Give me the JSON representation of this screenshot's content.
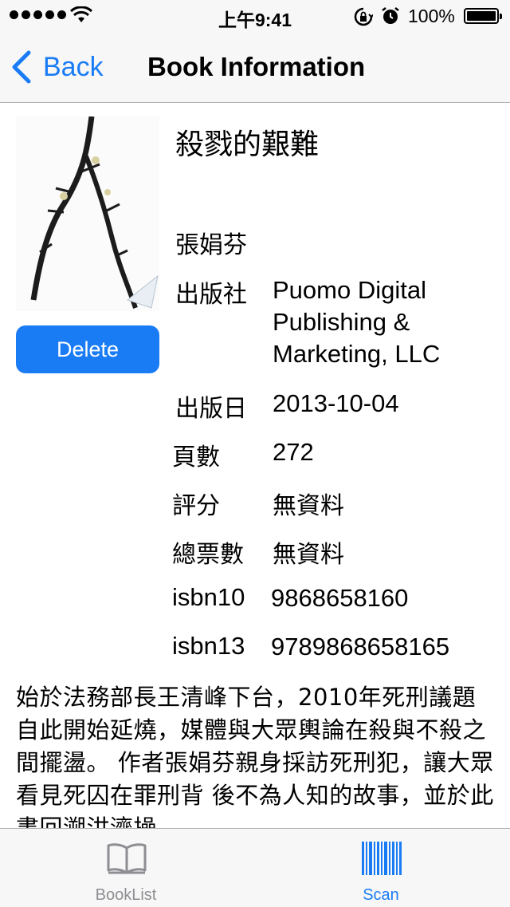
{
  "status_bar": {
    "time": "上午9:41",
    "battery": "100%"
  },
  "nav": {
    "back_label": "Back",
    "title": "Book Information"
  },
  "book": {
    "delete_label": "Delete",
    "title": "殺戮的艱難",
    "author": "張娟芬",
    "publisher_label": "出版社",
    "publisher_value": "Puomo Digital Publishing & Marketing, LLC",
    "date_label": "出版日",
    "date_value": "2013-10-04",
    "pages_label": "頁數",
    "pages_value": "272",
    "rating_label": "評分",
    "rating_value": "無資料",
    "votes_label": "總票數",
    "votes_value": "無資料",
    "isbn10_label": "isbn10",
    "isbn10_value": "9868658160",
    "isbn13_label": "isbn13",
    "isbn13_value": "9789868658165",
    "description": "始於法務部長王清峰下台，2010年死刑議題自此開始延燒，媒體與大眾輿論在殺與不殺之間擺盪。 作者張娟芬親身採訪死刑犯，讓大眾看見死囚在罪刑背 後不為人知的故事，並於此書回溯洪濟操"
  },
  "tabs": [
    {
      "label": "BookList",
      "icon": "book-icon",
      "selected": false
    },
    {
      "label": "Scan",
      "icon": "barcode-icon",
      "selected": true
    }
  ],
  "colors": {
    "accent": "#1a7cf5",
    "bar_bg": "#f7f7f7",
    "inactive_tab": "#8e8e93"
  }
}
